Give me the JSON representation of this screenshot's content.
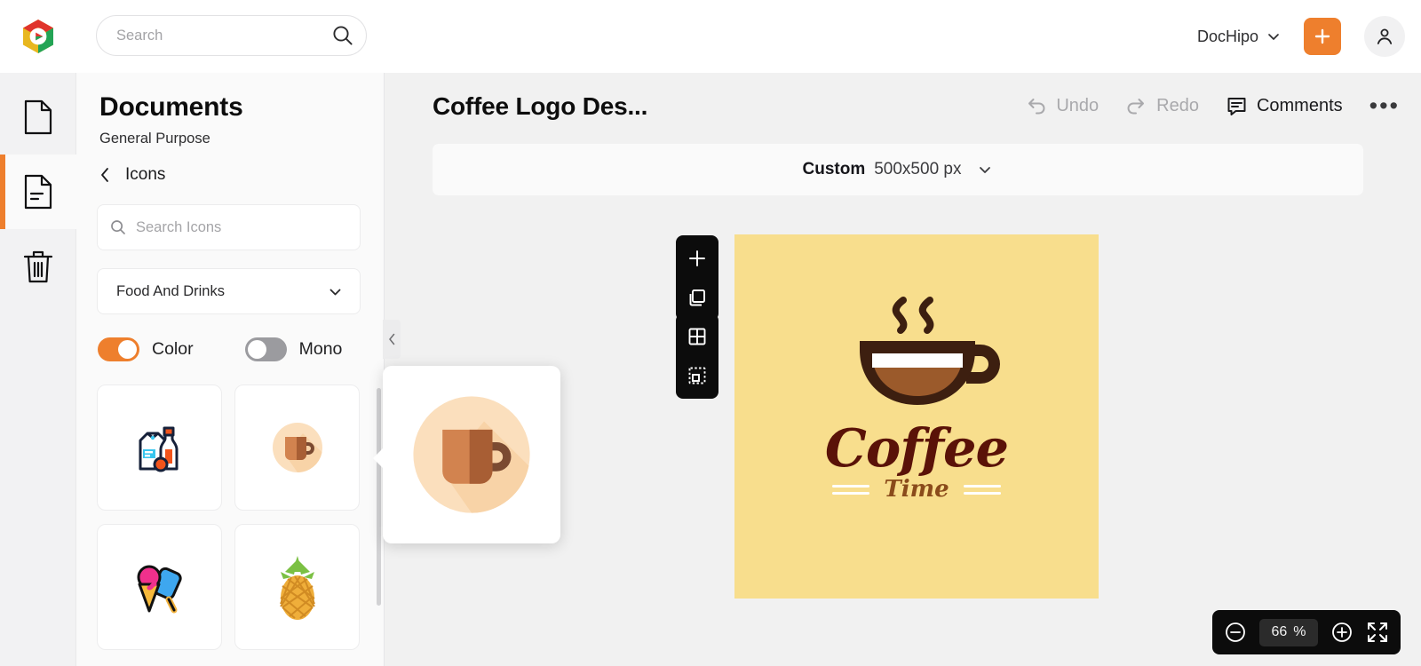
{
  "topbar": {
    "logo_icon": "dochipo-logo-icon",
    "search": {
      "placeholder": "Search",
      "value": "",
      "icon": "search-icon"
    },
    "workspace": {
      "label": "DocHipo",
      "chevron": "chevron-down-icon"
    },
    "create_button": {
      "icon": "plus-icon",
      "color": "#ee7f2d"
    },
    "account": {
      "icon": "user-avatar-icon"
    }
  },
  "rail": {
    "items": [
      {
        "name": "templates",
        "icon": "document-blank-icon",
        "active": false
      },
      {
        "name": "my-documents",
        "icon": "document-lines-icon",
        "active": true
      },
      {
        "name": "trash",
        "icon": "trash-icon",
        "active": false
      }
    ],
    "active_accent": "#ee7f2d"
  },
  "panel": {
    "title": "Documents",
    "subtitle": "General Purpose",
    "breadcrumb": {
      "back_icon": "chevron-left-icon",
      "label": "Icons"
    },
    "icon_search": {
      "placeholder": "Search Icons",
      "value": "",
      "icon": "search-icon"
    },
    "category": {
      "label": "Food And Drinks",
      "chevron": "chevron-down-icon"
    },
    "toggles": [
      {
        "label": "Color",
        "state": "on",
        "color": "#ee7f2d"
      },
      {
        "label": "Mono",
        "state": "off",
        "color": "#9b9b9f"
      }
    ],
    "icons": [
      {
        "name": "milk-and-bottle-icon"
      },
      {
        "name": "coffee-mug-icon"
      },
      {
        "name": "ice-cream-icon"
      },
      {
        "name": "pineapple-icon"
      }
    ],
    "collapse_tab": {
      "icon": "chevron-left-icon"
    },
    "preview": {
      "name": "coffee-mug-icon-preview"
    }
  },
  "editor": {
    "doc_title": "Coffee Logo Des...",
    "actions": [
      {
        "name": "undo",
        "label": "Undo",
        "icon": "undo-arrow-icon",
        "state": "disabled"
      },
      {
        "name": "redo",
        "label": "Redo",
        "icon": "redo-arrow-icon",
        "state": "disabled"
      },
      {
        "name": "comments",
        "label": "Comments",
        "icon": "comment-bubble-icon",
        "state": "enabled"
      },
      {
        "name": "more",
        "label": "",
        "icon": "more-horizontal-icon",
        "state": "enabled"
      }
    ],
    "size_bar": {
      "kind": "Custom",
      "dimensions": "500x500 px",
      "chevron": "chevron-down-icon"
    },
    "page_tools": [
      {
        "name": "add-page",
        "icon": "plus-icon"
      },
      {
        "name": "duplicate-page",
        "icon": "copy-pages-icon"
      },
      {
        "name": "grid-view",
        "icon": "grid-layout-icon"
      },
      {
        "name": "crop-selection",
        "icon": "crop-marquee-icon"
      }
    ],
    "canvas": {
      "background": "#f8de8d",
      "artwork_icon": "coffee-cup-with-steam-icon",
      "headline": "Coffee",
      "subline": "Time",
      "headline_color": "#5a1208",
      "subline_color": "#8a4b1b"
    },
    "zoom": {
      "out_icon": "minus-circle-icon",
      "value": "66",
      "unit": "%",
      "in_icon": "plus-circle-icon",
      "fullscreen_icon": "fullscreen-expand-icon"
    }
  }
}
